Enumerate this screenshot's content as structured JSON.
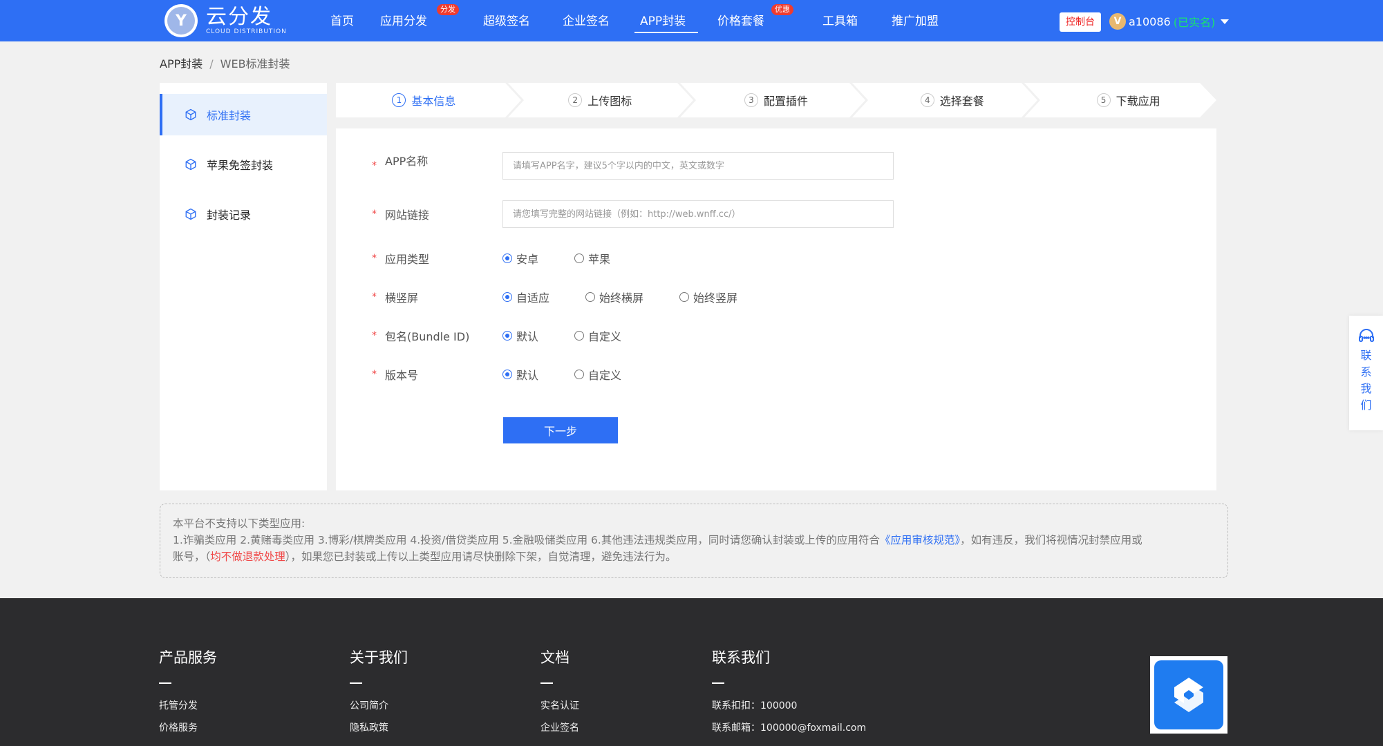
{
  "brand": {
    "logo_letter": "Y",
    "name": "云分发",
    "name_en": "CLOUD DISTRIBUTION",
    "color": "#2e6ff4"
  },
  "nav": {
    "items": [
      {
        "label": "首页",
        "badge": ""
      },
      {
        "label": "应用分发",
        "badge": "分发"
      },
      {
        "label": "超级签名",
        "badge": ""
      },
      {
        "label": "企业签名",
        "badge": ""
      },
      {
        "label": "APP封装",
        "badge": "",
        "active": true
      },
      {
        "label": "价格套餐",
        "badge": "优惠"
      },
      {
        "label": "工具箱",
        "badge": ""
      },
      {
        "label": "推广加盟",
        "badge": ""
      }
    ],
    "console_label": "控制台",
    "user_avatar": "V",
    "username": "a10086",
    "verified": "(已实名)"
  },
  "breadcrumb": {
    "parent": "APP封装",
    "separator": "/",
    "current": "WEB标准封装"
  },
  "sidebar": {
    "items": [
      {
        "label": "标准封装",
        "icon": "cube-icon",
        "active": true
      },
      {
        "label": "苹果免签封装",
        "icon": "cube-icon"
      },
      {
        "label": "封装记录",
        "icon": "cube-icon"
      }
    ]
  },
  "steps": [
    {
      "num": "1",
      "label": "基本信息",
      "active": true
    },
    {
      "num": "2",
      "label": "上传图标"
    },
    {
      "num": "3",
      "label": "配置插件"
    },
    {
      "num": "4",
      "label": "选择套餐"
    },
    {
      "num": "5",
      "label": "下载应用"
    }
  ],
  "form": {
    "required_mark": "*",
    "app_name": {
      "label": "APP名称",
      "placeholder": "请填写APP名字，建议5个字以内的中文，英文或数字",
      "value": ""
    },
    "site_url": {
      "label": "网站链接",
      "placeholder": "请您填写完整的网站链接（例如：http://web.wnff.cc/）",
      "value": ""
    },
    "app_type": {
      "label": "应用类型",
      "options": [
        "安卓",
        "苹果"
      ],
      "selected": "安卓"
    },
    "orientation": {
      "label": "横竖屏",
      "options": [
        "自适应",
        "始终横屏",
        "始终竖屏"
      ],
      "selected": "自适应"
    },
    "bundle_id": {
      "label": "包名(Bundle ID)",
      "options": [
        "默认",
        "自定义"
      ],
      "selected": "默认"
    },
    "version": {
      "label": "版本号",
      "options": [
        "默认",
        "自定义"
      ],
      "selected": "默认"
    },
    "next_label": "下一步"
  },
  "notice": {
    "title": "本平台不支持以下类型应用:",
    "line1_pre": "1.诈骗类应用 2.黄赌毒类应用 3.博彩/棋牌类应用 4.投资/借贷类应用 5.金融吸储类应用 6.其他违法违规类应用，同时请您确认封装或上传的应用符合",
    "link": "《应用审核规范》",
    "line1_post": "，如有违反，我们将视情况封禁应用或",
    "line2_pre": "账号，（",
    "warn": "均不做退款处理",
    "line2_post": "），如果您已封装或上传以上类型应用请尽快删除下架，自觉清理，避免违法行为。"
  },
  "float_contact": {
    "icon": "headset-icon",
    "chars": [
      "联",
      "系",
      "我",
      "们"
    ]
  },
  "footer": {
    "columns": [
      {
        "title": "产品服务",
        "links": [
          "托管分发",
          "价格服务"
        ]
      },
      {
        "title": "关于我们",
        "links": [
          "公司简介",
          "隐私政策"
        ]
      },
      {
        "title": "文档",
        "links": [
          "实名认证",
          "企业签名"
        ]
      },
      {
        "title": "联系我们",
        "links": [
          "联系扣扣：100000",
          "联系邮箱：100000@foxmail.com"
        ]
      }
    ],
    "qr_icon": "app-logo-icon"
  }
}
